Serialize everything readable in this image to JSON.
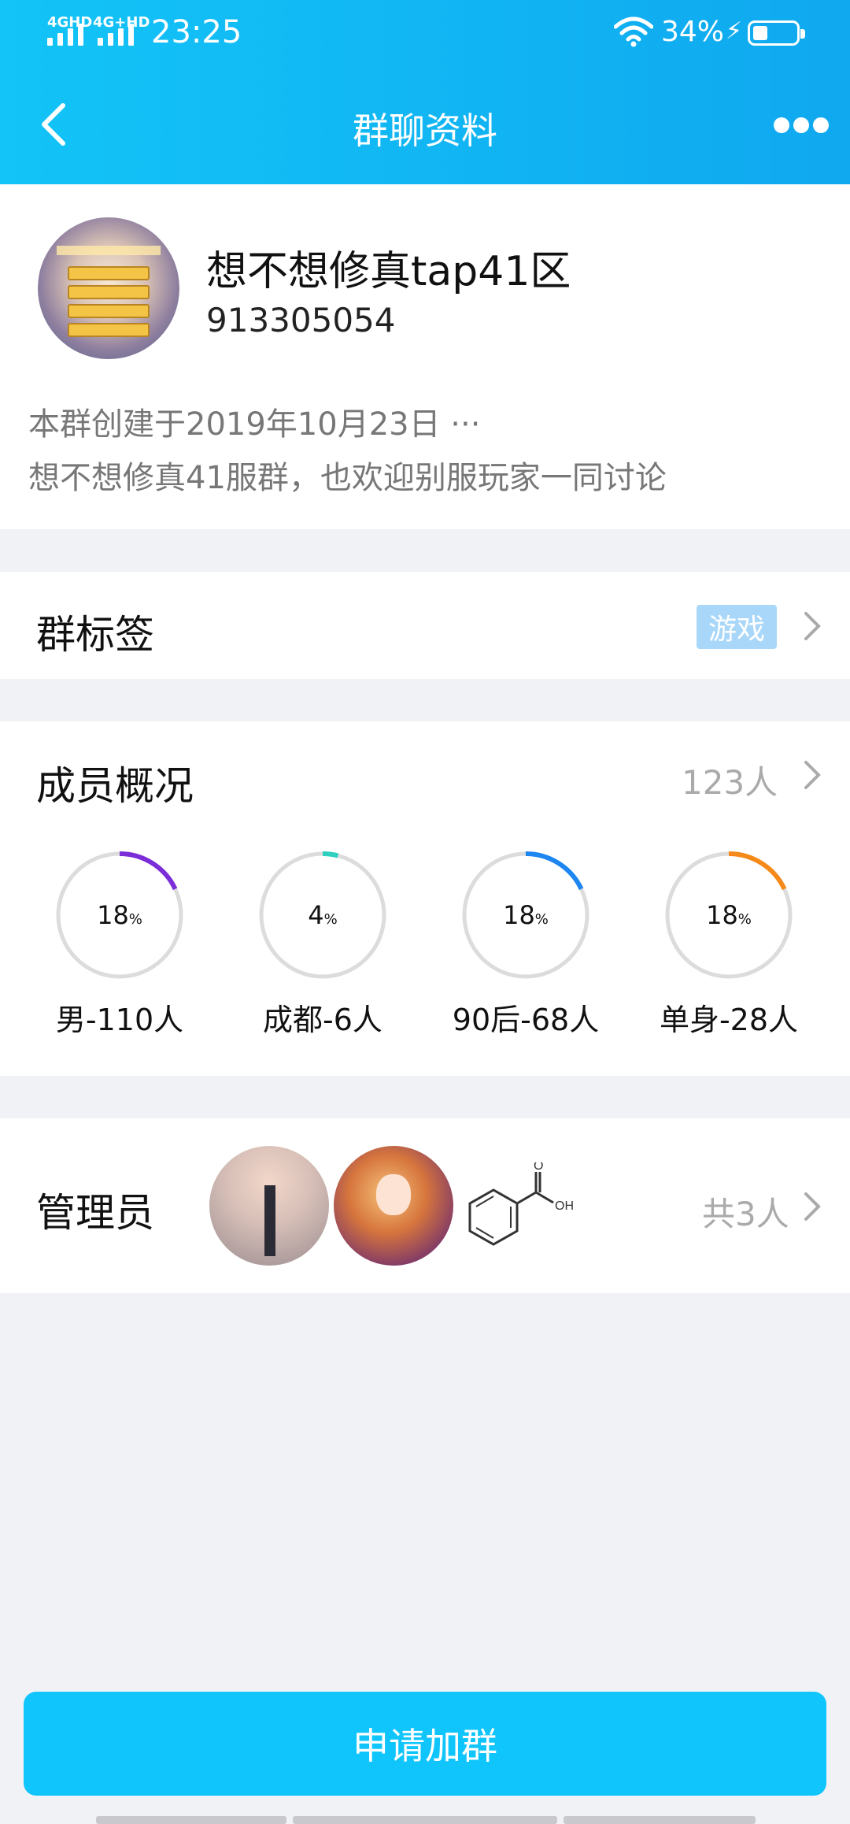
{
  "status_bar": {
    "sim1": "4GHD",
    "sim2": "4G+HD",
    "time": "23:25",
    "battery_percent": "34%",
    "battery_level": 0.34
  },
  "nav": {
    "back_icon": "chevron-left-icon",
    "title": "群聊资料",
    "more_icon": "more-dots-icon"
  },
  "group": {
    "name": "想不想修真tap41区",
    "id": "913305054",
    "created_line": "本群创建于2019年10月23日 ···",
    "description": "想不想修真41服群，也欢迎别服玩家一同讨论"
  },
  "tags_row": {
    "label": "群标签",
    "tag": "游戏"
  },
  "members_row": {
    "label": "成员概况",
    "count": "123人",
    "stats": [
      {
        "pct": "18",
        "unit": "%",
        "label": "男-110人",
        "fraction": 0.18,
        "color": "#7b2ed8"
      },
      {
        "pct": "4",
        "unit": "%",
        "label": "成都-6人",
        "fraction": 0.04,
        "color": "#2fd0c0"
      },
      {
        "pct": "18",
        "unit": "%",
        "label": "90后-68人",
        "fraction": 0.18,
        "color": "#1d86f0"
      },
      {
        "pct": "18",
        "unit": "%",
        "label": "单身-28人",
        "fraction": 0.18,
        "color": "#f58a1a"
      }
    ]
  },
  "admins_row": {
    "label": "管理员",
    "count": "共3人",
    "structure_text": "OH"
  },
  "join_button": "申请加群",
  "colors": {
    "accent": "#0fc5fb",
    "tag_bg": "#a9d7f9"
  }
}
